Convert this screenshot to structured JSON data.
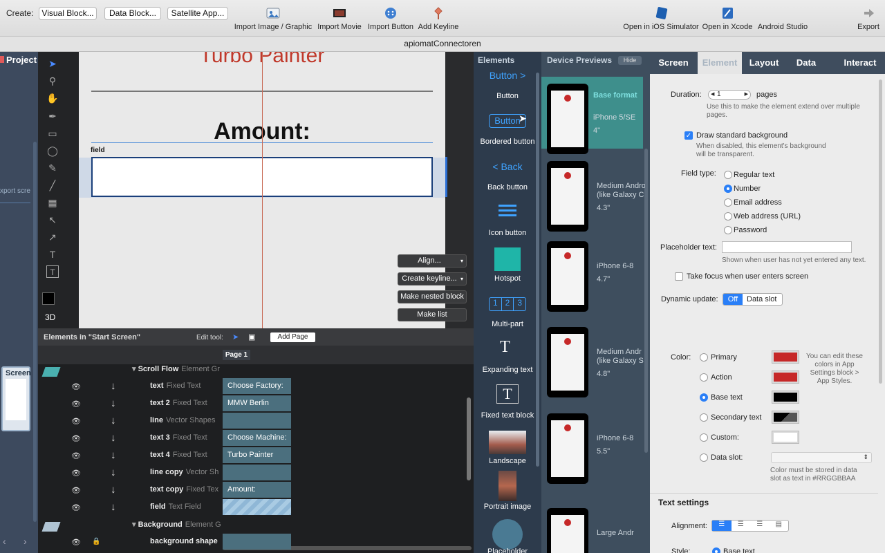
{
  "toolbar": {
    "create_label": "Create:",
    "visual_block": "Visual Block...",
    "data_block": "Data Block...",
    "satellite_app": "Satellite App...",
    "import_image": "Import Image / Graphic",
    "import_movie": "Import Movie",
    "import_button": "Import Button",
    "add_keyline": "Add Keyline",
    "open_ios": "Open in iOS Simulator",
    "open_xcode": "Open in Xcode",
    "android_studio": "Android Studio",
    "export": "Export"
  },
  "window_title": "apiomatConnectoren",
  "left": {
    "project": "Project",
    "export_screen": "xport scre",
    "screen_thumb": "Screen"
  },
  "tools": {
    "threed": "3D"
  },
  "canvas": {
    "title_text": "Turbo Painter",
    "amount_label": "Amount:",
    "field_label": "field",
    "align": "Align...",
    "create_keyline": "Create keyline...",
    "make_nested": "Make nested block",
    "make_list": "Make list"
  },
  "elements_panel": {
    "title": "Elements in \"Start Screen\"",
    "edit_tool": "Edit tool:",
    "add_page": "Add Page",
    "page1": "Page 1",
    "rows": [
      {
        "name": "Scroll Flow",
        "type": "Element Gr",
        "cell": ""
      },
      {
        "name": "text",
        "type": "Fixed Text",
        "cell": "Choose Factory:"
      },
      {
        "name": "text 2",
        "type": "Fixed Text",
        "cell": "MMW Berlin"
      },
      {
        "name": "line",
        "type": "Vector Shapes",
        "cell": ""
      },
      {
        "name": "text 3",
        "type": "Fixed Text",
        "cell": "Choose Machine:"
      },
      {
        "name": "text 4",
        "type": "Fixed Text",
        "cell": "Turbo Painter"
      },
      {
        "name": "line copy",
        "type": "Vector Sh",
        "cell": ""
      },
      {
        "name": "text copy",
        "type": "Fixed Tex",
        "cell": "Amount:"
      },
      {
        "name": "field",
        "type": "Text Field",
        "cell": ""
      },
      {
        "name": "Background",
        "type": "Element G",
        "cell": ""
      },
      {
        "name": "background shape",
        "type": "",
        "cell": ""
      }
    ]
  },
  "palette": {
    "title": "Elements",
    "items": [
      "Button",
      "Bordered button",
      "Back button",
      "Icon button",
      "Hotspot",
      "Multi-part",
      "Expanding text",
      "Fixed text block",
      "Landscape",
      "Portrait image",
      "Placeholder"
    ],
    "button_sample": "Button >",
    "bordered_sample": "Button",
    "back_sample": "< Back",
    "multi_sample": [
      "1",
      "2",
      "3"
    ]
  },
  "devices": {
    "title": "Device Previews",
    "hide": "Hide",
    "items": [
      {
        "name": "Base format",
        "sub": "iPhone 5/SE",
        "size": "4\""
      },
      {
        "name": "Medium Andro",
        "sub": "(like Galaxy C",
        "size": "4.3\""
      },
      {
        "name": "iPhone 6-8",
        "sub": "",
        "size": "4.7\""
      },
      {
        "name": "Medium Andr",
        "sub": "(like Galaxy S",
        "size": "4.8\""
      },
      {
        "name": "iPhone 6-8",
        "sub": "",
        "size": "5.5\""
      },
      {
        "name": "Large Andr",
        "sub": "",
        "size": ""
      }
    ]
  },
  "inspector": {
    "tabs": [
      "Screen",
      "Element",
      "Layout",
      "Data",
      "Interact"
    ],
    "active_tab": "Element",
    "duration_label": "Duration:",
    "duration_value": "1",
    "pages": "pages",
    "duration_hint": "Use this to make the element extend over multiple pages.",
    "draw_bg": "Draw standard background",
    "draw_bg_hint": "When disabled, this element's background will be transparent.",
    "field_type_label": "Field type:",
    "field_types": [
      "Regular text",
      "Number",
      "Email address",
      "Web address (URL)",
      "Password"
    ],
    "field_type_selected": "Number",
    "placeholder_label": "Placeholder text:",
    "placeholder_value": "",
    "placeholder_hint": "Shown when user has not yet entered any text.",
    "take_focus": "Take focus when user enters screen",
    "dynamic_label": "Dynamic update:",
    "dyn_off": "Off",
    "dyn_slot": "Data slot",
    "color_label": "Color:",
    "colors": [
      "Primary",
      "Action",
      "Base text",
      "Secondary text",
      "Custom:",
      "Data slot:"
    ],
    "color_selected": "Base text",
    "color_hint": "You can edit these colors in App Settings block > App Styles.",
    "slot_hint": "Color must be stored in data slot as text in #RRGGBBAA",
    "text_settings": "Text settings",
    "alignment": "Alignment:",
    "style": "Style:",
    "style_value": "Base text",
    "swatches": {
      "primary": "#c62828",
      "action": "#c62828",
      "base": "#000000",
      "secondary": "#333333",
      "custom": "#ffffff"
    }
  }
}
